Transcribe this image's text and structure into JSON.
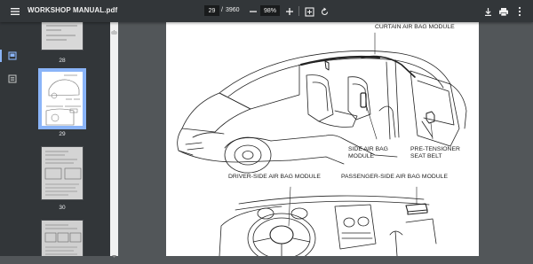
{
  "toolbar": {
    "title": "WORKSHOP MANUAL.pdf",
    "current_page": "29",
    "separator": "/",
    "total_pages": "3960",
    "zoom": "98%",
    "zoom_out_label": "−",
    "zoom_in_label": "+"
  },
  "thumbnails": [
    {
      "page": "28"
    },
    {
      "page": "29",
      "selected": true
    },
    {
      "page": "30"
    }
  ],
  "document": {
    "labels": {
      "curtain": "CURTAIN AIR BAG MODULE",
      "side_line1": "SIDE AIR BAG",
      "side_line2": "MODULE",
      "pretensioner_line1": "PRE-TENSIONER",
      "pretensioner_line2": "SEAT BELT",
      "driver": "DRIVER-SIDE AIR BAG MODULE",
      "passenger": "PASSENGER-SIDE AIR BAG MODULE"
    }
  },
  "colors": {
    "toolbar_bg": "#323639",
    "viewer_bg": "#525659",
    "selection_accent": "#8ab4f8"
  },
  "icons": [
    "menu-icon",
    "zoom-out-icon",
    "zoom-in-icon",
    "fit-page-icon",
    "rotate-icon",
    "download-icon",
    "print-icon",
    "more-vert-icon",
    "thumbnails-icon",
    "outline-icon"
  ]
}
